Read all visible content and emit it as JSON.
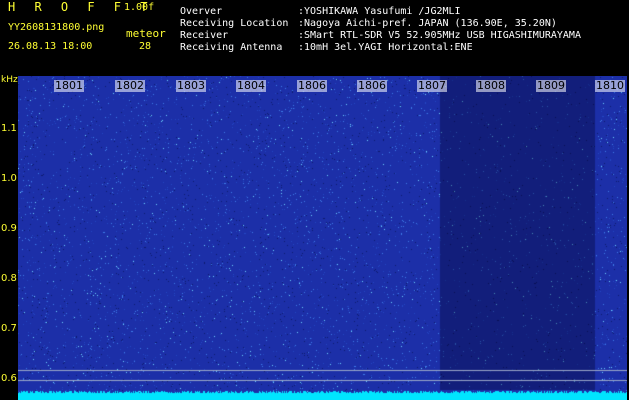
{
  "header": {
    "title": "H R O F F T",
    "version": "1.00f",
    "filename": "YY2608131800.png",
    "meteor_label": "meteor",
    "datetime": "26.08.13 18:00",
    "meteor_count": "28"
  },
  "info": [
    {
      "label": "Overver",
      "value": ":YOSHIKAWA Yasufumi /JG2MLI"
    },
    {
      "label": "Receiving Location",
      "value": ":Nagoya Aichi-pref. JAPAN (136.90E, 35.20N)"
    },
    {
      "label": "Receiver",
      "value": ":SMart RTL-SDR V5 52.905MHz USB HIGASHIMURAYAMA"
    },
    {
      "label": "Receiving Antenna",
      "value": ":10mH 3el.YAGI Horizontal:ENE"
    }
  ],
  "spectrogram": {
    "y_unit": "kHz",
    "y_ticks": [
      "1.1",
      "1.0",
      "0.9",
      "0.8",
      "0.7",
      "0.6"
    ],
    "x_ticks": [
      "1801",
      "1802",
      "1803",
      "1804",
      "1806",
      "1806",
      "1807",
      "1808",
      "1809",
      "1810"
    ],
    "colors": {
      "background": "#1c2fa8",
      "noise_bright": "#6fd6ff",
      "baseline": "#00e5ff",
      "reference_line": "#9aa7c7"
    }
  }
}
